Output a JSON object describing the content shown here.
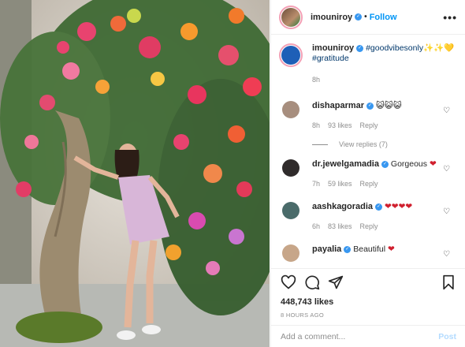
{
  "header": {
    "username": "imouniroy",
    "follow_label": "Follow",
    "more_label": "•••"
  },
  "caption": {
    "username": "imouniroy",
    "text": "#goodvibesonly✨✨💛",
    "tag2": "#gratitude",
    "time": "8h"
  },
  "comments": [
    {
      "username": "dishaparmar",
      "text": "😺😺😺",
      "time": "8h",
      "likes": "93 likes",
      "reply": "Reply",
      "avatar_color": "#a78e7e"
    },
    {
      "username": "dr.jewelgamadia",
      "text": "Gorgeous",
      "emoji": "❤",
      "time": "7h",
      "likes": "59 likes",
      "reply": "Reply",
      "avatar_color": "#2f2b2b"
    },
    {
      "username": "aashkagoradia",
      "text": "❤❤❤❤",
      "time": "6h",
      "likes": "83 likes",
      "reply": "Reply",
      "avatar_color": "#4a6b6a"
    },
    {
      "username": "payalia",
      "text": "Beautiful",
      "emoji": "❤",
      "time": "",
      "likes": "",
      "reply": "",
      "avatar_color": "#c7a689"
    }
  ],
  "view_replies": "View replies (7)",
  "post_stats": {
    "likes": "448,743 likes",
    "ago": "8 HOURS AGO"
  },
  "add_comment": {
    "placeholder": "Add a comment...",
    "post_label": "Post"
  },
  "colors": {
    "accent": "#0095f6",
    "verified": "#3897f0",
    "muted": "#8e8e8e",
    "heart_red": "#d01f2e"
  },
  "icons": [
    "heart-icon",
    "comment-icon",
    "share-icon",
    "bookmark-icon",
    "verified-icon",
    "more-icon"
  ]
}
